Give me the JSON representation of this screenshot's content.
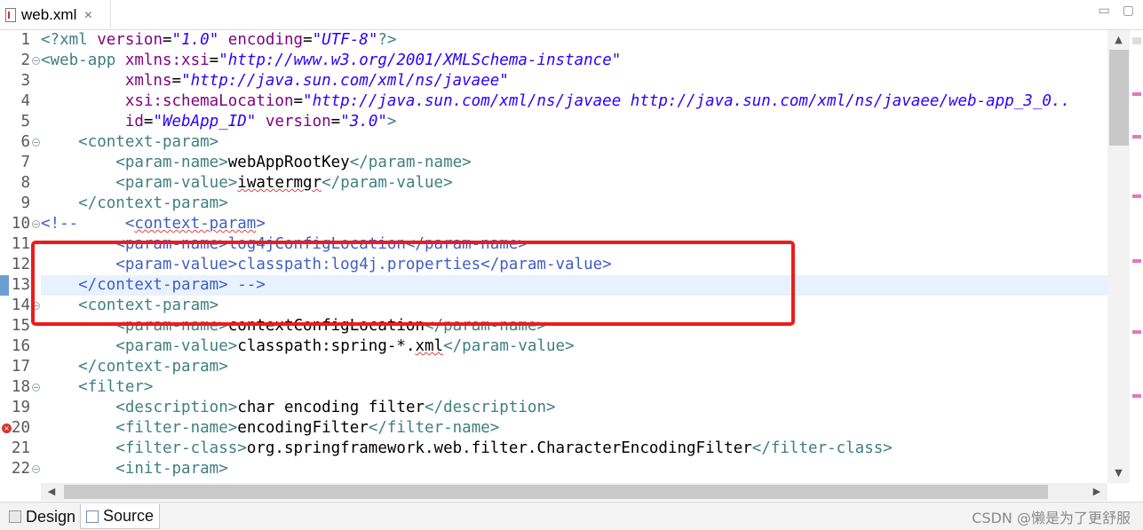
{
  "tab": {
    "title": "web.xml",
    "close_icon": "close-icon"
  },
  "editor": {
    "lines": [
      {
        "num": "1",
        "fold": false,
        "segs": [
          [
            "c-tag",
            "<?"
          ],
          [
            "c-el",
            "xml "
          ],
          [
            "c-attr",
            "version"
          ],
          [
            "c-text",
            "="
          ],
          [
            "c-val",
            "\"1.0\""
          ],
          [
            "c-text",
            " "
          ],
          [
            "c-attr",
            "encoding"
          ],
          [
            "c-text",
            "="
          ],
          [
            "c-val",
            "\"UTF-8\""
          ],
          [
            "c-tag",
            "?>"
          ]
        ]
      },
      {
        "num": "2",
        "fold": true,
        "segs": [
          [
            "c-tag",
            "<"
          ],
          [
            "c-el",
            "web-app "
          ],
          [
            "c-attr",
            "xmlns:xsi"
          ],
          [
            "c-text",
            "="
          ],
          [
            "c-val",
            "\"http://www.w3.org/2001/XMLSchema-instance\""
          ]
        ]
      },
      {
        "num": "3",
        "fold": false,
        "segs": [
          [
            "c-text",
            "         "
          ],
          [
            "c-attr",
            "xmlns"
          ],
          [
            "c-text",
            "="
          ],
          [
            "c-val",
            "\"http://java.sun.com/xml/ns/javaee\""
          ]
        ]
      },
      {
        "num": "4",
        "fold": false,
        "segs": [
          [
            "c-text",
            "         "
          ],
          [
            "c-attr",
            "xsi:schemaLocation"
          ],
          [
            "c-text",
            "="
          ],
          [
            "c-val",
            "\"http://java.sun.com/xml/ns/javaee http://java.sun.com/xml/ns/javaee/web-app_3_0.."
          ]
        ]
      },
      {
        "num": "5",
        "fold": false,
        "segs": [
          [
            "c-text",
            "         "
          ],
          [
            "c-attr",
            "id"
          ],
          [
            "c-text",
            "="
          ],
          [
            "c-val",
            "\"WebApp_ID\""
          ],
          [
            "c-text",
            " "
          ],
          [
            "c-attr",
            "version"
          ],
          [
            "c-text",
            "="
          ],
          [
            "c-val",
            "\"3.0\""
          ],
          [
            "c-tag",
            ">"
          ]
        ]
      },
      {
        "num": "6",
        "fold": true,
        "segs": [
          [
            "c-text",
            "    "
          ],
          [
            "c-tag",
            "<"
          ],
          [
            "c-el",
            "context-param"
          ],
          [
            "c-tag",
            ">"
          ]
        ]
      },
      {
        "num": "7",
        "fold": false,
        "segs": [
          [
            "c-text",
            "        "
          ],
          [
            "c-tag",
            "<"
          ],
          [
            "c-el",
            "param-name"
          ],
          [
            "c-tag",
            ">"
          ],
          [
            "c-text",
            "webAppRootKey"
          ],
          [
            "c-tag",
            "</"
          ],
          [
            "c-el",
            "param-name"
          ],
          [
            "c-tag",
            ">"
          ]
        ]
      },
      {
        "num": "8",
        "fold": false,
        "segs": [
          [
            "c-text",
            "        "
          ],
          [
            "c-tag",
            "<"
          ],
          [
            "c-el",
            "param-value"
          ],
          [
            "c-tag",
            ">"
          ],
          [
            "c-text squig",
            "iwatermgr"
          ],
          [
            "c-tag",
            "</"
          ],
          [
            "c-el",
            "param-value"
          ],
          [
            "c-tag",
            ">"
          ]
        ]
      },
      {
        "num": "9",
        "fold": false,
        "segs": [
          [
            "c-text",
            "    "
          ],
          [
            "c-tag",
            "</"
          ],
          [
            "c-el",
            "context-param"
          ],
          [
            "c-tag",
            ">"
          ]
        ]
      },
      {
        "num": "10",
        "fold": true,
        "segs": [
          [
            "c-comment",
            "<!--     <"
          ],
          [
            "c-comment squig",
            "context-param"
          ],
          [
            "c-comment",
            ">"
          ]
        ]
      },
      {
        "num": "11",
        "fold": false,
        "segs": [
          [
            "c-comment",
            "        <param-name>log4jConfigLocation</param-name>"
          ]
        ]
      },
      {
        "num": "12",
        "fold": false,
        "segs": [
          [
            "c-comment",
            "        <param-value>classpath:log4j.properties</param-value>"
          ]
        ]
      },
      {
        "num": "13",
        "fold": false,
        "current": true,
        "segs": [
          [
            "c-comment",
            "    </context-param> -->"
          ]
        ]
      },
      {
        "num": "14",
        "fold": true,
        "segs": [
          [
            "c-text",
            "    "
          ],
          [
            "c-tag",
            "<"
          ],
          [
            "c-el",
            "context-param"
          ],
          [
            "c-tag",
            ">"
          ]
        ]
      },
      {
        "num": "15",
        "fold": false,
        "segs": [
          [
            "c-text",
            "        "
          ],
          [
            "c-tag",
            "<"
          ],
          [
            "c-el",
            "param-name"
          ],
          [
            "c-tag",
            ">"
          ],
          [
            "c-text",
            "contextConfigLocation"
          ],
          [
            "c-tag",
            "</"
          ],
          [
            "c-el",
            "param-name"
          ],
          [
            "c-tag",
            ">"
          ]
        ]
      },
      {
        "num": "16",
        "fold": false,
        "segs": [
          [
            "c-text",
            "        "
          ],
          [
            "c-tag",
            "<"
          ],
          [
            "c-el",
            "param-value"
          ],
          [
            "c-tag",
            ">"
          ],
          [
            "c-text",
            "classpath:spring-*."
          ],
          [
            "c-text squig",
            "xml"
          ],
          [
            "c-tag",
            "</"
          ],
          [
            "c-el",
            "param-value"
          ],
          [
            "c-tag",
            ">"
          ]
        ]
      },
      {
        "num": "17",
        "fold": false,
        "segs": [
          [
            "c-text",
            "    "
          ],
          [
            "c-tag",
            "</"
          ],
          [
            "c-el",
            "context-param"
          ],
          [
            "c-tag",
            ">"
          ]
        ]
      },
      {
        "num": "18",
        "fold": true,
        "segs": [
          [
            "c-text",
            "    "
          ],
          [
            "c-tag",
            "<"
          ],
          [
            "c-el",
            "filter"
          ],
          [
            "c-tag",
            ">"
          ]
        ]
      },
      {
        "num": "19",
        "fold": false,
        "segs": [
          [
            "c-text",
            "        "
          ],
          [
            "c-tag",
            "<"
          ],
          [
            "c-el",
            "description"
          ],
          [
            "c-tag",
            ">"
          ],
          [
            "c-text",
            "char encoding filter"
          ],
          [
            "c-tag",
            "</"
          ],
          [
            "c-el",
            "description"
          ],
          [
            "c-tag",
            ">"
          ]
        ]
      },
      {
        "num": "20",
        "fold": false,
        "error": true,
        "segs": [
          [
            "c-text",
            "        "
          ],
          [
            "c-tag",
            "<"
          ],
          [
            "c-el",
            "filter-name"
          ],
          [
            "c-tag",
            ">"
          ],
          [
            "c-text",
            "encodingFilter"
          ],
          [
            "c-tag",
            "</"
          ],
          [
            "c-el",
            "filter-name"
          ],
          [
            "c-tag",
            ">"
          ]
        ]
      },
      {
        "num": "21",
        "fold": false,
        "segs": [
          [
            "c-text",
            "        "
          ],
          [
            "c-tag",
            "<"
          ],
          [
            "c-el",
            "filter-class"
          ],
          [
            "c-tag",
            ">"
          ],
          [
            "c-text",
            "org.springframework.web.filter.CharacterEncodingFilter"
          ],
          [
            "c-tag",
            "</"
          ],
          [
            "c-el",
            "filter-class"
          ],
          [
            "c-tag",
            ">"
          ]
        ]
      },
      {
        "num": "22",
        "fold": true,
        "segs": [
          [
            "c-text",
            "        "
          ],
          [
            "c-tag",
            "<"
          ],
          [
            "c-el",
            "init-param"
          ],
          [
            "c-tag",
            ">"
          ]
        ]
      }
    ]
  },
  "bottom_tabs": [
    {
      "label": "Design",
      "active": false
    },
    {
      "label": "Source",
      "active": true
    }
  ],
  "watermark": "CSDN @懒是为了更舒服",
  "colors": {
    "highlight": "#ee1b1b",
    "current_line": "#e8f2fe"
  }
}
